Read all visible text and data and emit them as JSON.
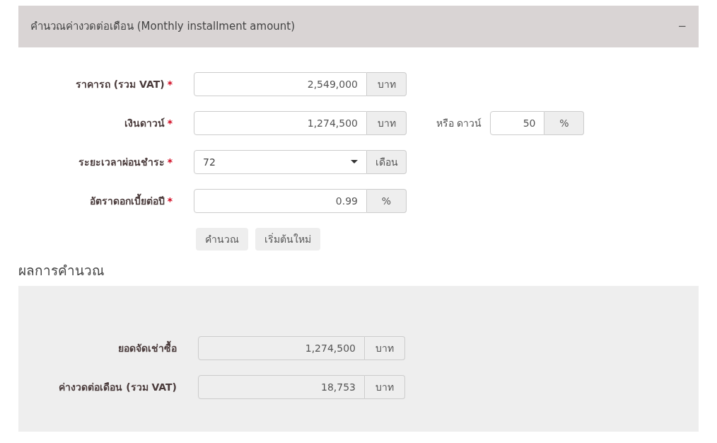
{
  "panel": {
    "title": "คำนวณค่างวดต่อเดือน (Monthly installment amount)",
    "toggle": "−",
    "expanded": true
  },
  "fields": [
    {
      "kind": "input",
      "label": "ราคารถ (รวม VAT)",
      "required": "*",
      "value": "2,549,000",
      "unit": "บาท"
    },
    {
      "kind": "input",
      "label": "เงินดาวน์",
      "required": "*",
      "value": "1,274,500",
      "unit": "บาท",
      "alt": {
        "label": "หรือ ดาวน์",
        "value": "50",
        "unit": "%"
      }
    },
    {
      "kind": "select",
      "label": "ระยะเวลาผ่อนชำระ",
      "required": "*",
      "value": "72",
      "unit": "เดือน"
    },
    {
      "kind": "input",
      "label": "อัตราดอกเบี้ยต่อปี",
      "required": "*",
      "value": "0.99",
      "unit": "%"
    }
  ],
  "buttons": [
    "คำนวณ",
    "เริ่มต้นใหม่"
  ],
  "results": {
    "title": "ผลการคำนวณ",
    "rows": [
      {
        "label": "ยอดจัดเช่าซื้อ",
        "value": "1,274,500",
        "unit": "บาท"
      },
      {
        "label": "ค่างวดต่อเดือน (รวม VAT)",
        "value": "18,753",
        "unit": "บาท"
      }
    ]
  }
}
